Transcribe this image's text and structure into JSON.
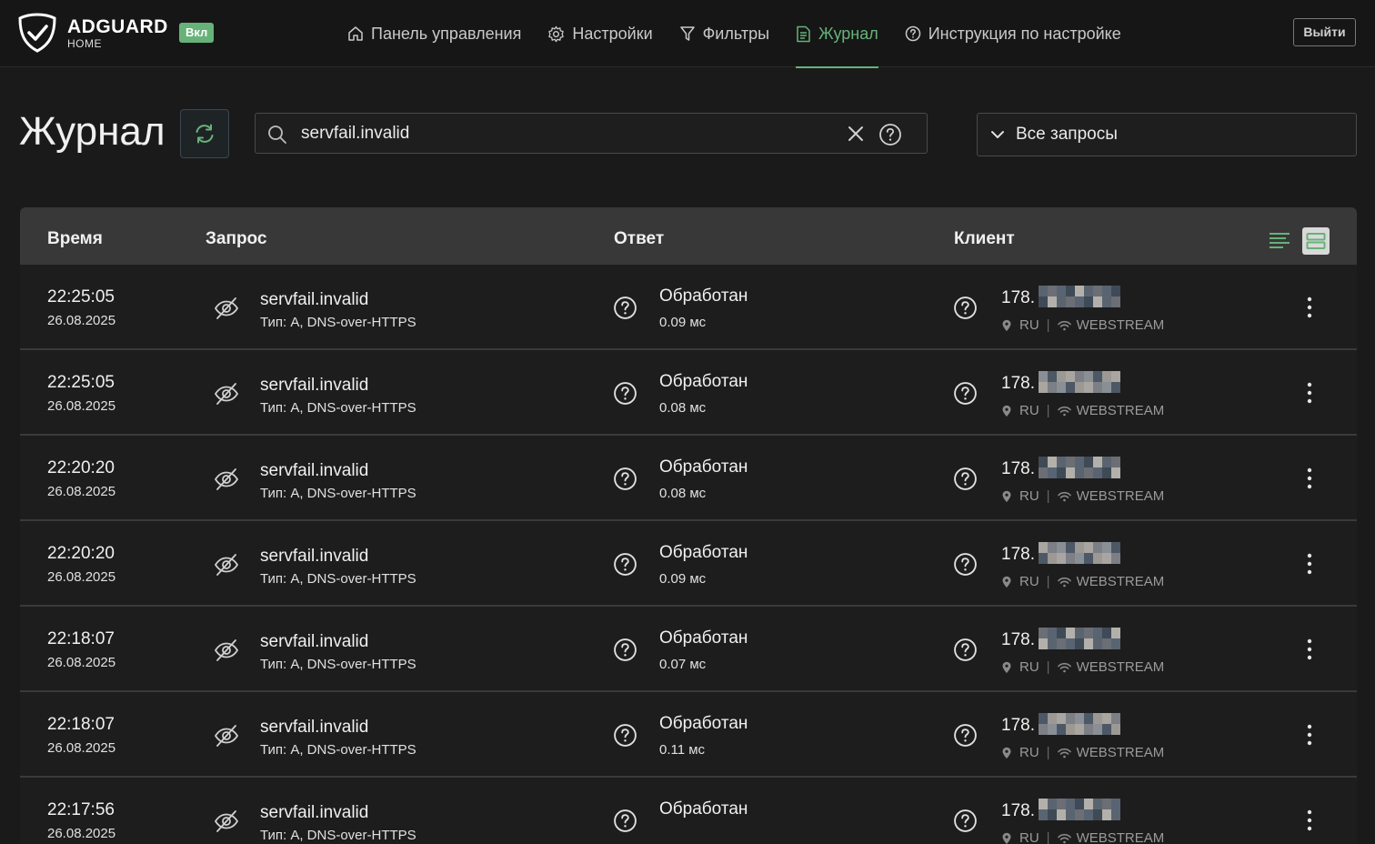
{
  "header": {
    "brand": "ADGUARD",
    "brand_sub": "HOME",
    "status_badge": "Вкл",
    "nav": [
      {
        "label": "Панель управления",
        "icon": "home-icon",
        "active": false
      },
      {
        "label": "Настройки",
        "icon": "gear-icon",
        "active": false
      },
      {
        "label": "Фильтры",
        "icon": "filter-icon",
        "active": false
      },
      {
        "label": "Журнал",
        "icon": "document-icon",
        "active": true
      },
      {
        "label": "Инструкция по настройке",
        "icon": "help-circle-icon",
        "active": false
      }
    ],
    "logout": "Выйти"
  },
  "page": {
    "title": "Журнал",
    "search_value": "servfail.invalid",
    "filter_selected": "Все запросы"
  },
  "table": {
    "columns": [
      "Время",
      "Запрос",
      "Ответ",
      "Клиент"
    ],
    "rows": [
      {
        "time": "22:25:05",
        "date": "26.08.2025",
        "domain": "servfail.invalid",
        "type": "Тип: A, DNS-over-HTTPS",
        "status": "Обработан",
        "elapsed": "0.09 мс",
        "ip": "178.",
        "country": "RU",
        "network": "WEBSTREAM"
      },
      {
        "time": "22:25:05",
        "date": "26.08.2025",
        "domain": "servfail.invalid",
        "type": "Тип: A, DNS-over-HTTPS",
        "status": "Обработан",
        "elapsed": "0.08 мс",
        "ip": "178.",
        "country": "RU",
        "network": "WEBSTREAM"
      },
      {
        "time": "22:20:20",
        "date": "26.08.2025",
        "domain": "servfail.invalid",
        "type": "Тип: A, DNS-over-HTTPS",
        "status": "Обработан",
        "elapsed": "0.08 мс",
        "ip": "178.",
        "country": "RU",
        "network": "WEBSTREAM"
      },
      {
        "time": "22:20:20",
        "date": "26.08.2025",
        "domain": "servfail.invalid",
        "type": "Тип: A, DNS-over-HTTPS",
        "status": "Обработан",
        "elapsed": "0.09 мс",
        "ip": "178.",
        "country": "RU",
        "network": "WEBSTREAM"
      },
      {
        "time": "22:18:07",
        "date": "26.08.2025",
        "domain": "servfail.invalid",
        "type": "Тип: A, DNS-over-HTTPS",
        "status": "Обработан",
        "elapsed": "0.07 мс",
        "ip": "178.",
        "country": "RU",
        "network": "WEBSTREAM"
      },
      {
        "time": "22:18:07",
        "date": "26.08.2025",
        "domain": "servfail.invalid",
        "type": "Тип: A, DNS-over-HTTPS",
        "status": "Обработан",
        "elapsed": "0.11 мс",
        "ip": "178.",
        "country": "RU",
        "network": "WEBSTREAM"
      },
      {
        "time": "22:17:56",
        "date": "26.08.2025",
        "domain": "servfail.invalid",
        "type": "Тип: A, DNS-over-HTTPS",
        "status": "Обработан",
        "elapsed": "",
        "ip": "178.",
        "country": "RU",
        "network": "WEBSTREAM"
      }
    ]
  },
  "colors": {
    "accent": "#67b279",
    "background": "#1a1a1a",
    "header_row": "#383838"
  }
}
